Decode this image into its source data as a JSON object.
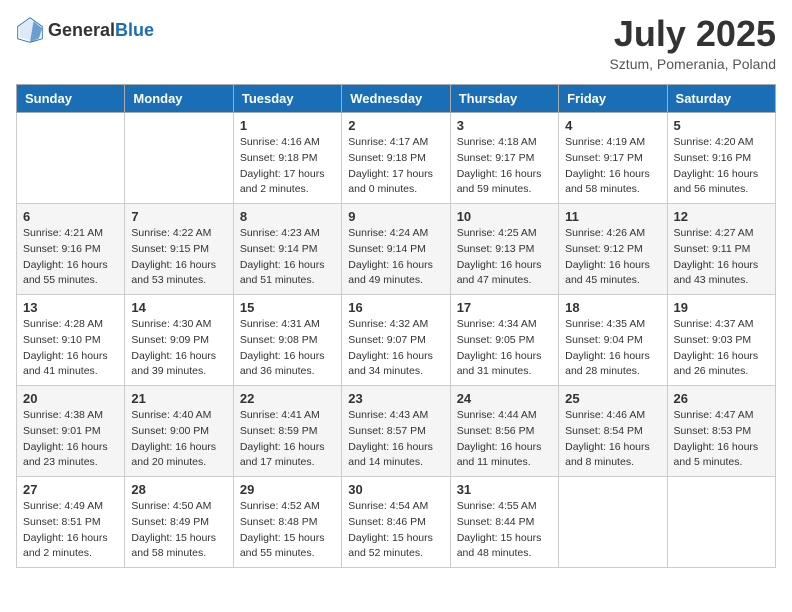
{
  "header": {
    "logo_general": "General",
    "logo_blue": "Blue",
    "month": "July 2025",
    "location": "Sztum, Pomerania, Poland"
  },
  "weekdays": [
    "Sunday",
    "Monday",
    "Tuesday",
    "Wednesday",
    "Thursday",
    "Friday",
    "Saturday"
  ],
  "weeks": [
    [
      {
        "day": "",
        "sunrise": "",
        "sunset": "",
        "daylight": ""
      },
      {
        "day": "",
        "sunrise": "",
        "sunset": "",
        "daylight": ""
      },
      {
        "day": "1",
        "sunrise": "Sunrise: 4:16 AM",
        "sunset": "Sunset: 9:18 PM",
        "daylight": "Daylight: 17 hours and 2 minutes."
      },
      {
        "day": "2",
        "sunrise": "Sunrise: 4:17 AM",
        "sunset": "Sunset: 9:18 PM",
        "daylight": "Daylight: 17 hours and 0 minutes."
      },
      {
        "day": "3",
        "sunrise": "Sunrise: 4:18 AM",
        "sunset": "Sunset: 9:17 PM",
        "daylight": "Daylight: 16 hours and 59 minutes."
      },
      {
        "day": "4",
        "sunrise": "Sunrise: 4:19 AM",
        "sunset": "Sunset: 9:17 PM",
        "daylight": "Daylight: 16 hours and 58 minutes."
      },
      {
        "day": "5",
        "sunrise": "Sunrise: 4:20 AM",
        "sunset": "Sunset: 9:16 PM",
        "daylight": "Daylight: 16 hours and 56 minutes."
      }
    ],
    [
      {
        "day": "6",
        "sunrise": "Sunrise: 4:21 AM",
        "sunset": "Sunset: 9:16 PM",
        "daylight": "Daylight: 16 hours and 55 minutes."
      },
      {
        "day": "7",
        "sunrise": "Sunrise: 4:22 AM",
        "sunset": "Sunset: 9:15 PM",
        "daylight": "Daylight: 16 hours and 53 minutes."
      },
      {
        "day": "8",
        "sunrise": "Sunrise: 4:23 AM",
        "sunset": "Sunset: 9:14 PM",
        "daylight": "Daylight: 16 hours and 51 minutes."
      },
      {
        "day": "9",
        "sunrise": "Sunrise: 4:24 AM",
        "sunset": "Sunset: 9:14 PM",
        "daylight": "Daylight: 16 hours and 49 minutes."
      },
      {
        "day": "10",
        "sunrise": "Sunrise: 4:25 AM",
        "sunset": "Sunset: 9:13 PM",
        "daylight": "Daylight: 16 hours and 47 minutes."
      },
      {
        "day": "11",
        "sunrise": "Sunrise: 4:26 AM",
        "sunset": "Sunset: 9:12 PM",
        "daylight": "Daylight: 16 hours and 45 minutes."
      },
      {
        "day": "12",
        "sunrise": "Sunrise: 4:27 AM",
        "sunset": "Sunset: 9:11 PM",
        "daylight": "Daylight: 16 hours and 43 minutes."
      }
    ],
    [
      {
        "day": "13",
        "sunrise": "Sunrise: 4:28 AM",
        "sunset": "Sunset: 9:10 PM",
        "daylight": "Daylight: 16 hours and 41 minutes."
      },
      {
        "day": "14",
        "sunrise": "Sunrise: 4:30 AM",
        "sunset": "Sunset: 9:09 PM",
        "daylight": "Daylight: 16 hours and 39 minutes."
      },
      {
        "day": "15",
        "sunrise": "Sunrise: 4:31 AM",
        "sunset": "Sunset: 9:08 PM",
        "daylight": "Daylight: 16 hours and 36 minutes."
      },
      {
        "day": "16",
        "sunrise": "Sunrise: 4:32 AM",
        "sunset": "Sunset: 9:07 PM",
        "daylight": "Daylight: 16 hours and 34 minutes."
      },
      {
        "day": "17",
        "sunrise": "Sunrise: 4:34 AM",
        "sunset": "Sunset: 9:05 PM",
        "daylight": "Daylight: 16 hours and 31 minutes."
      },
      {
        "day": "18",
        "sunrise": "Sunrise: 4:35 AM",
        "sunset": "Sunset: 9:04 PM",
        "daylight": "Daylight: 16 hours and 28 minutes."
      },
      {
        "day": "19",
        "sunrise": "Sunrise: 4:37 AM",
        "sunset": "Sunset: 9:03 PM",
        "daylight": "Daylight: 16 hours and 26 minutes."
      }
    ],
    [
      {
        "day": "20",
        "sunrise": "Sunrise: 4:38 AM",
        "sunset": "Sunset: 9:01 PM",
        "daylight": "Daylight: 16 hours and 23 minutes."
      },
      {
        "day": "21",
        "sunrise": "Sunrise: 4:40 AM",
        "sunset": "Sunset: 9:00 PM",
        "daylight": "Daylight: 16 hours and 20 minutes."
      },
      {
        "day": "22",
        "sunrise": "Sunrise: 4:41 AM",
        "sunset": "Sunset: 8:59 PM",
        "daylight": "Daylight: 16 hours and 17 minutes."
      },
      {
        "day": "23",
        "sunrise": "Sunrise: 4:43 AM",
        "sunset": "Sunset: 8:57 PM",
        "daylight": "Daylight: 16 hours and 14 minutes."
      },
      {
        "day": "24",
        "sunrise": "Sunrise: 4:44 AM",
        "sunset": "Sunset: 8:56 PM",
        "daylight": "Daylight: 16 hours and 11 minutes."
      },
      {
        "day": "25",
        "sunrise": "Sunrise: 4:46 AM",
        "sunset": "Sunset: 8:54 PM",
        "daylight": "Daylight: 16 hours and 8 minutes."
      },
      {
        "day": "26",
        "sunrise": "Sunrise: 4:47 AM",
        "sunset": "Sunset: 8:53 PM",
        "daylight": "Daylight: 16 hours and 5 minutes."
      }
    ],
    [
      {
        "day": "27",
        "sunrise": "Sunrise: 4:49 AM",
        "sunset": "Sunset: 8:51 PM",
        "daylight": "Daylight: 16 hours and 2 minutes."
      },
      {
        "day": "28",
        "sunrise": "Sunrise: 4:50 AM",
        "sunset": "Sunset: 8:49 PM",
        "daylight": "Daylight: 15 hours and 58 minutes."
      },
      {
        "day": "29",
        "sunrise": "Sunrise: 4:52 AM",
        "sunset": "Sunset: 8:48 PM",
        "daylight": "Daylight: 15 hours and 55 minutes."
      },
      {
        "day": "30",
        "sunrise": "Sunrise: 4:54 AM",
        "sunset": "Sunset: 8:46 PM",
        "daylight": "Daylight: 15 hours and 52 minutes."
      },
      {
        "day": "31",
        "sunrise": "Sunrise: 4:55 AM",
        "sunset": "Sunset: 8:44 PM",
        "daylight": "Daylight: 15 hours and 48 minutes."
      },
      {
        "day": "",
        "sunrise": "",
        "sunset": "",
        "daylight": ""
      },
      {
        "day": "",
        "sunrise": "",
        "sunset": "",
        "daylight": ""
      }
    ]
  ]
}
